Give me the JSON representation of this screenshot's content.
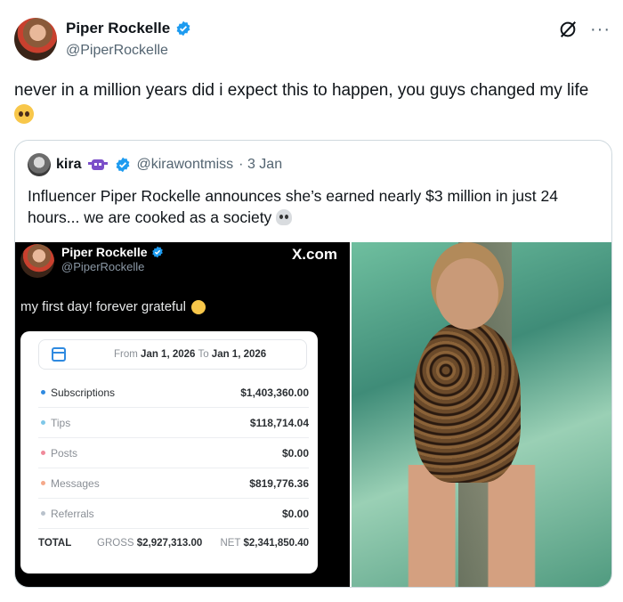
{
  "tweet": {
    "author_name": "Piper Rockelle",
    "author_handle": "@PiperRockelle",
    "text": "never in a million years did i expect this to happen, you guys changed my life"
  },
  "quote": {
    "author_name": "kira",
    "author_handle": "@kirawontmiss",
    "date": "· 3 Jan",
    "text": "Influencer Piper Rockelle announces she’s earned nearly $3 million in just 24 hours... we are cooked as a society"
  },
  "screenshot": {
    "name": "Piper Rockelle",
    "handle": "@PiperRockelle",
    "brand": "X.com",
    "post_text": "my first day! forever grateful",
    "date_from_label": "From",
    "date_from": "Jan 1, 2026",
    "date_to_label": "To",
    "date_to": "Jan 1, 2026",
    "rows": [
      {
        "label": "Subscriptions",
        "value": "$1,403,360.00",
        "dot": "#2f8ae0",
        "label_color": "#2b2f33"
      },
      {
        "label": "Tips",
        "value": "$118,714.04",
        "dot": "#7fc7e8",
        "label_color": "#8a8f96"
      },
      {
        "label": "Posts",
        "value": "$0.00",
        "dot": "#f08a9a",
        "label_color": "#8a8f96"
      },
      {
        "label": "Messages",
        "value": "$819,776.36",
        "dot": "#f5a98a",
        "label_color": "#8a8f96"
      },
      {
        "label": "Referrals",
        "value": "$0.00",
        "dot": "#b9c2cc",
        "label_color": "#8a8f96"
      }
    ],
    "total_label": "TOTAL",
    "gross_label": "GROSS",
    "gross_value": "$2,927,313.00",
    "net_label": "NET",
    "net_value": "$2,341,850.40"
  },
  "colors": {
    "verified": "#1d9bf0",
    "handle": "#536471"
  },
  "icons": [
    "verified-icon",
    "grok-icon",
    "more-icon",
    "pleading-face-emoji",
    "skull-emoji",
    "calendar-icon"
  ]
}
